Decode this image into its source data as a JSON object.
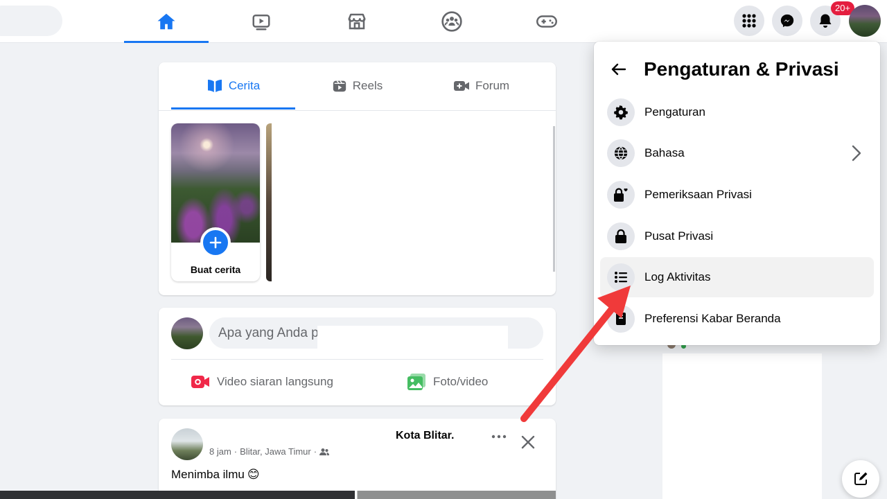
{
  "topbar": {
    "nav": [
      "home-icon",
      "watch-icon",
      "marketplace-icon",
      "groups-icon",
      "gaming-icon"
    ],
    "notification_badge": "20+",
    "accent_color": "#1877f2"
  },
  "stories": {
    "tabs": [
      {
        "label": "Cerita",
        "icon": "book-icon"
      },
      {
        "label": "Reels",
        "icon": "reels-icon"
      },
      {
        "label": "Forum",
        "icon": "video-camera-icon"
      }
    ],
    "create_label": "Buat cerita"
  },
  "composer": {
    "placeholder": "Apa yang Anda p",
    "actions": [
      {
        "label": "Video siaran langsung",
        "icon": "live-video-icon",
        "color": "#f02849"
      },
      {
        "label": "Foto/video",
        "icon": "photo-icon",
        "color": "#45bd62"
      }
    ]
  },
  "post": {
    "author": "Kota Blitar.",
    "time": "8 jam",
    "location": "Blitar, Jawa Timur",
    "text": "Menimba ilmu",
    "emoji": "😊"
  },
  "dropdown": {
    "title": "Pengaturan & Privasi",
    "items": [
      {
        "label": "Pengaturan",
        "icon": "gear-icon"
      },
      {
        "label": "Bahasa",
        "icon": "globe-icon",
        "has_submenu": true
      },
      {
        "label": "Pemeriksaan Privasi",
        "icon": "lock-heart-icon"
      },
      {
        "label": "Pusat Privasi",
        "icon": "lock-icon"
      },
      {
        "label": "Log Aktivitas",
        "icon": "list-icon",
        "highlighted": true
      },
      {
        "label": "Preferensi Kabar Beranda",
        "icon": "feed-preferences-icon"
      }
    ]
  },
  "annotation": {
    "arrow_color": "#f03a3a"
  }
}
